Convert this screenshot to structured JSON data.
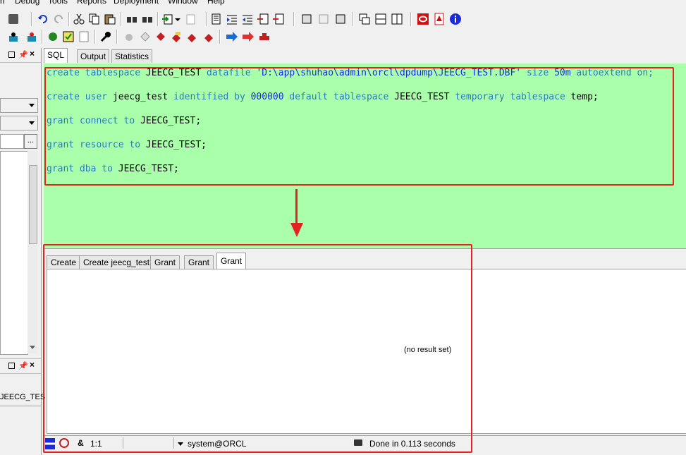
{
  "menu": [
    "n",
    "Debug",
    "Tools",
    "Reports",
    "Deployment",
    "Window",
    "Help"
  ],
  "editor_tabs": [
    {
      "label": "SQL",
      "active": true
    },
    {
      "label": "Output",
      "active": false
    },
    {
      "label": "Statistics",
      "active": false
    }
  ],
  "sql": {
    "line1": {
      "kw1": "create tablespace ",
      "name": "JEECG_TEST",
      "kw2": " datafile ",
      "path": "'D:\\app\\shuhao\\admin\\orcl\\dpdump\\JEECG_TEST.DBF'",
      "kw3": " size ",
      "size": "50m",
      "kw4": " autoextend on;"
    },
    "line2": {
      "kw1": "create user ",
      "user": "jeecg_test",
      "kw2": " identified by ",
      "pwd": "000000",
      "kw3": " default tablespace ",
      "ts": "JEECG_TEST",
      "kw4": " temporary tablespace ",
      "tmp": "temp;"
    },
    "line3": {
      "kw": "grant connect to ",
      "name": "JEECG_TEST;"
    },
    "line4": {
      "kw": "grant resource to ",
      "name": "JEECG_TEST;"
    },
    "line5": {
      "kw": "grant dba to ",
      "name": "JEECG_TEST;"
    }
  },
  "result_tabs": [
    {
      "label": "Create",
      "active": false
    },
    {
      "label": "Create jeecg_test",
      "active": false
    },
    {
      "label": "Grant",
      "active": false
    },
    {
      "label": "Grant",
      "active": false
    },
    {
      "label": "Grant",
      "active": true
    }
  ],
  "result_message": "(no result set)",
  "status": {
    "position": "1:1",
    "connection": "system@ORCL",
    "done": "Done in 0.113 seconds"
  },
  "left_panel": {
    "object_label": "JEECG_TES",
    "browse_button": "..."
  },
  "colors": {
    "editor_bg": "#aaffaa",
    "keyword": "#2b7bb9",
    "annotation_red": "#e52222"
  }
}
